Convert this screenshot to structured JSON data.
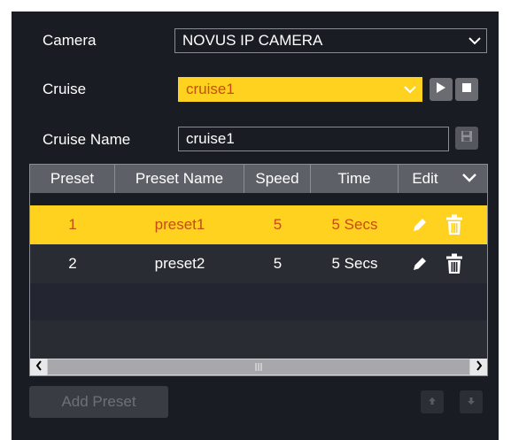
{
  "form": {
    "camera_label": "Camera",
    "camera_value": "NOVUS IP CAMERA",
    "cruise_label": "Cruise",
    "cruise_value": "cruise1",
    "cruise_name_label": "Cruise Name",
    "cruise_name_value": "cruise1"
  },
  "table": {
    "headers": [
      "Preset",
      "Preset Name",
      "Speed",
      "Time",
      "Edit"
    ],
    "rows": [
      {
        "preset": "1",
        "name": "preset1",
        "speed": "5",
        "time": "5 Secs",
        "selected": true
      },
      {
        "preset": "2",
        "name": "preset2",
        "speed": "5",
        "time": "5 Secs",
        "selected": false
      }
    ]
  },
  "actions": {
    "add_preset_label": "Add Preset"
  },
  "colors": {
    "accent_yellow": "#ffd21f",
    "selected_text": "#c64c10",
    "panel_bg": "#1a1c23",
    "header_bg": "#5e6068"
  },
  "icons": {
    "play": "play-icon",
    "stop": "stop-icon",
    "save": "save-icon",
    "edit": "pencil-icon",
    "delete": "trash-icon",
    "move_up": "arrow-up-icon",
    "move_down": "arrow-down-icon"
  }
}
